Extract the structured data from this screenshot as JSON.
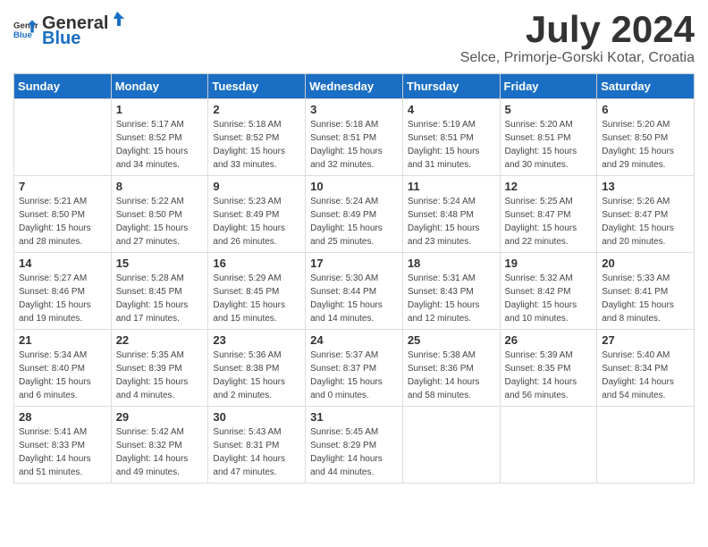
{
  "logo": {
    "general": "General",
    "blue": "Blue"
  },
  "title": "July 2024",
  "location": "Selce, Primorje-Gorski Kotar, Croatia",
  "days_of_week": [
    "Sunday",
    "Monday",
    "Tuesday",
    "Wednesday",
    "Thursday",
    "Friday",
    "Saturday"
  ],
  "weeks": [
    [
      {
        "day": "",
        "info": ""
      },
      {
        "day": "1",
        "info": "Sunrise: 5:17 AM\nSunset: 8:52 PM\nDaylight: 15 hours\nand 34 minutes."
      },
      {
        "day": "2",
        "info": "Sunrise: 5:18 AM\nSunset: 8:52 PM\nDaylight: 15 hours\nand 33 minutes."
      },
      {
        "day": "3",
        "info": "Sunrise: 5:18 AM\nSunset: 8:51 PM\nDaylight: 15 hours\nand 32 minutes."
      },
      {
        "day": "4",
        "info": "Sunrise: 5:19 AM\nSunset: 8:51 PM\nDaylight: 15 hours\nand 31 minutes."
      },
      {
        "day": "5",
        "info": "Sunrise: 5:20 AM\nSunset: 8:51 PM\nDaylight: 15 hours\nand 30 minutes."
      },
      {
        "day": "6",
        "info": "Sunrise: 5:20 AM\nSunset: 8:50 PM\nDaylight: 15 hours\nand 29 minutes."
      }
    ],
    [
      {
        "day": "7",
        "info": "Sunrise: 5:21 AM\nSunset: 8:50 PM\nDaylight: 15 hours\nand 28 minutes."
      },
      {
        "day": "8",
        "info": "Sunrise: 5:22 AM\nSunset: 8:50 PM\nDaylight: 15 hours\nand 27 minutes."
      },
      {
        "day": "9",
        "info": "Sunrise: 5:23 AM\nSunset: 8:49 PM\nDaylight: 15 hours\nand 26 minutes."
      },
      {
        "day": "10",
        "info": "Sunrise: 5:24 AM\nSunset: 8:49 PM\nDaylight: 15 hours\nand 25 minutes."
      },
      {
        "day": "11",
        "info": "Sunrise: 5:24 AM\nSunset: 8:48 PM\nDaylight: 15 hours\nand 23 minutes."
      },
      {
        "day": "12",
        "info": "Sunrise: 5:25 AM\nSunset: 8:47 PM\nDaylight: 15 hours\nand 22 minutes."
      },
      {
        "day": "13",
        "info": "Sunrise: 5:26 AM\nSunset: 8:47 PM\nDaylight: 15 hours\nand 20 minutes."
      }
    ],
    [
      {
        "day": "14",
        "info": "Sunrise: 5:27 AM\nSunset: 8:46 PM\nDaylight: 15 hours\nand 19 minutes."
      },
      {
        "day": "15",
        "info": "Sunrise: 5:28 AM\nSunset: 8:45 PM\nDaylight: 15 hours\nand 17 minutes."
      },
      {
        "day": "16",
        "info": "Sunrise: 5:29 AM\nSunset: 8:45 PM\nDaylight: 15 hours\nand 15 minutes."
      },
      {
        "day": "17",
        "info": "Sunrise: 5:30 AM\nSunset: 8:44 PM\nDaylight: 15 hours\nand 14 minutes."
      },
      {
        "day": "18",
        "info": "Sunrise: 5:31 AM\nSunset: 8:43 PM\nDaylight: 15 hours\nand 12 minutes."
      },
      {
        "day": "19",
        "info": "Sunrise: 5:32 AM\nSunset: 8:42 PM\nDaylight: 15 hours\nand 10 minutes."
      },
      {
        "day": "20",
        "info": "Sunrise: 5:33 AM\nSunset: 8:41 PM\nDaylight: 15 hours\nand 8 minutes."
      }
    ],
    [
      {
        "day": "21",
        "info": "Sunrise: 5:34 AM\nSunset: 8:40 PM\nDaylight: 15 hours\nand 6 minutes."
      },
      {
        "day": "22",
        "info": "Sunrise: 5:35 AM\nSunset: 8:39 PM\nDaylight: 15 hours\nand 4 minutes."
      },
      {
        "day": "23",
        "info": "Sunrise: 5:36 AM\nSunset: 8:38 PM\nDaylight: 15 hours\nand 2 minutes."
      },
      {
        "day": "24",
        "info": "Sunrise: 5:37 AM\nSunset: 8:37 PM\nDaylight: 15 hours\nand 0 minutes."
      },
      {
        "day": "25",
        "info": "Sunrise: 5:38 AM\nSunset: 8:36 PM\nDaylight: 14 hours\nand 58 minutes."
      },
      {
        "day": "26",
        "info": "Sunrise: 5:39 AM\nSunset: 8:35 PM\nDaylight: 14 hours\nand 56 minutes."
      },
      {
        "day": "27",
        "info": "Sunrise: 5:40 AM\nSunset: 8:34 PM\nDaylight: 14 hours\nand 54 minutes."
      }
    ],
    [
      {
        "day": "28",
        "info": "Sunrise: 5:41 AM\nSunset: 8:33 PM\nDaylight: 14 hours\nand 51 minutes."
      },
      {
        "day": "29",
        "info": "Sunrise: 5:42 AM\nSunset: 8:32 PM\nDaylight: 14 hours\nand 49 minutes."
      },
      {
        "day": "30",
        "info": "Sunrise: 5:43 AM\nSunset: 8:31 PM\nDaylight: 14 hours\nand 47 minutes."
      },
      {
        "day": "31",
        "info": "Sunrise: 5:45 AM\nSunset: 8:29 PM\nDaylight: 14 hours\nand 44 minutes."
      },
      {
        "day": "",
        "info": ""
      },
      {
        "day": "",
        "info": ""
      },
      {
        "day": "",
        "info": ""
      }
    ]
  ]
}
